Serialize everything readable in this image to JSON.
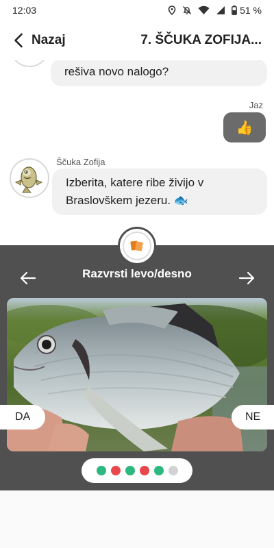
{
  "status_bar": {
    "time": "12:03",
    "battery": "51 %",
    "icons": [
      "location-icon",
      "silent-bell-icon",
      "wifi-icon",
      "signal-icon",
      "battery-icon"
    ]
  },
  "header": {
    "back_label": "Nazaj",
    "title": "7. ŠČUKA ZOFIJA..."
  },
  "chat": {
    "messages": [
      {
        "sender": "",
        "text": "rešiva novo nalogo?"
      },
      {
        "sender": "Jaz",
        "text": "👍"
      },
      {
        "sender": "Ščuka Zofija",
        "text": "Izberita, katere ribe živijo v Braslovškem jezeru. 🐟"
      }
    ]
  },
  "sort_panel": {
    "title": "Razvrsti levo/desno",
    "left_choice": "DA",
    "right_choice": "NE",
    "badge_icon": "cards-icon",
    "progress": [
      {
        "color": "#2db87f",
        "state": "correct"
      },
      {
        "color": "#e8474c",
        "state": "wrong"
      },
      {
        "color": "#2db87f",
        "state": "correct"
      },
      {
        "color": "#e8474c",
        "state": "wrong"
      },
      {
        "color": "#2db87f",
        "state": "correct"
      },
      {
        "color": "#d3d3d3",
        "state": "pending"
      }
    ]
  },
  "colors": {
    "panel_bg": "#505050",
    "bubble_bg": "#f1f1f1",
    "my_bubble_bg": "#6b6b6b",
    "accent": "#f08a24"
  }
}
